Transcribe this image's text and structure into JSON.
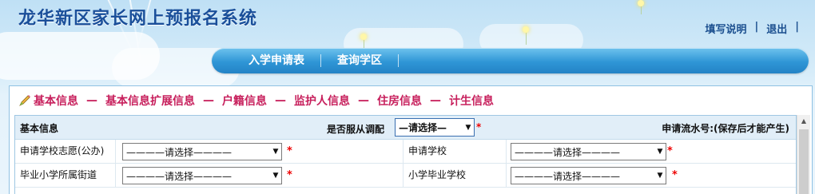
{
  "header": {
    "title": "龙华新区家长网上预报名系统",
    "links": [
      {
        "label": "填写说明"
      },
      {
        "label": "退出"
      }
    ],
    "separator": "|"
  },
  "nav": {
    "items": [
      {
        "label": "入学申请表"
      },
      {
        "label": "查询学区"
      }
    ]
  },
  "sections": {
    "icon": "pencil-icon",
    "dash": "—",
    "items": [
      "基本信息",
      "基本信息扩展信息",
      "户籍信息",
      "监护人信息",
      "住房信息",
      "计生信息"
    ]
  },
  "form": {
    "header_title": "基本信息",
    "adjust_label": "是否服从调配",
    "adjust_select_value": "—请选择—",
    "required_mark": "*",
    "serial_label": "申请流水号:(保存后才能产生)",
    "rows": [
      {
        "label_left": "申请学校志愿(公办)",
        "select_left": "————请选择————",
        "label_right": "申请学校",
        "select_right": "————请选择————"
      },
      {
        "label_left": "毕业小学所属街道",
        "select_left": "————请选择————",
        "label_right": "小学毕业学校",
        "select_right": "————请选择————"
      }
    ]
  },
  "colors": {
    "title": "#1a4f9a",
    "nav": "#2f96d6",
    "section_link": "#c71f5c",
    "required": "#ee0000"
  }
}
